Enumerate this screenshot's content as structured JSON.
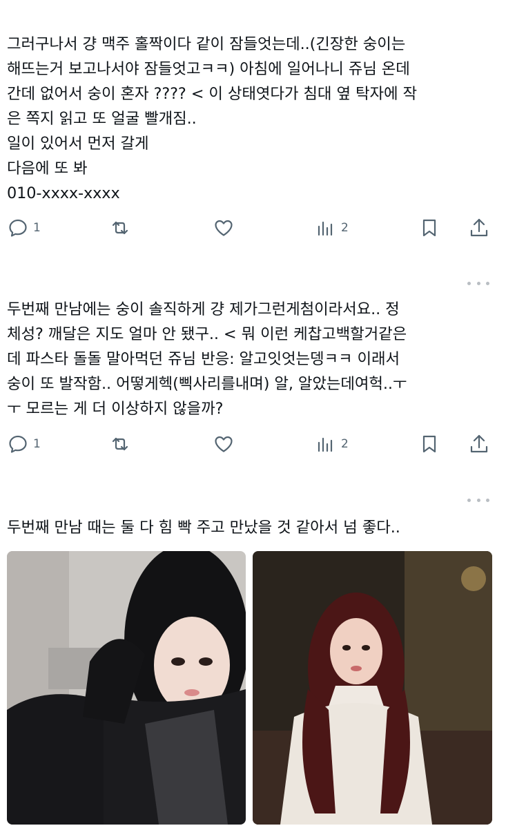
{
  "tweets": [
    {
      "text": "그러구나서 걍 맥주 홀짝이다 같이 잠들엇는데..(긴장한 숭이는\n해뜨는거 보고나서야 잠들엇고ㅋㅋ) 아침에 일어나니 쥬님 온데\n간데 없어서 숭이 혼자 ???? < 이 상태엿다가 침대 옆 탁자에 작\n은 쪽지 읽고 또 얼굴 빨개짐..\n일이 있어서 먼저 갈게\n다음에 또 봐\n010-xxxx-xxxx",
      "replies": "1",
      "views": "2"
    },
    {
      "text": "두번째 만남에는 숭이 솔직하게 걍 제가그런게첨이라서요.. 정\n체성? 깨달은 지도 얼마 안 됐구.. < 뭐 이런 케찹고백할거같은\n데 파스타 돌돌 말아먹던 쥬님 반응: 알고잇엇는뎅ㅋㅋ 이래서\n숭이 또 발작함.. 어떻게헥(삑사리를내며) 알, 알았는데여헉..ㅜ\nㅜ 모르는 게 더 이상하지 않을까?",
      "replies": "1",
      "views": "2"
    },
    {
      "text": "두번째 만남 때는 둘 다 힘 빡 주고 만났을 것 같아서 넘 좋다.."
    }
  ],
  "icons": {
    "reply": "reply-icon",
    "retweet": "retweet-icon",
    "like": "heart-icon",
    "views": "analytics-icon",
    "bookmark": "bookmark-icon",
    "share": "share-icon",
    "more": "more-icon"
  },
  "colors": {
    "icon": "#536471",
    "text": "#0f1419"
  }
}
